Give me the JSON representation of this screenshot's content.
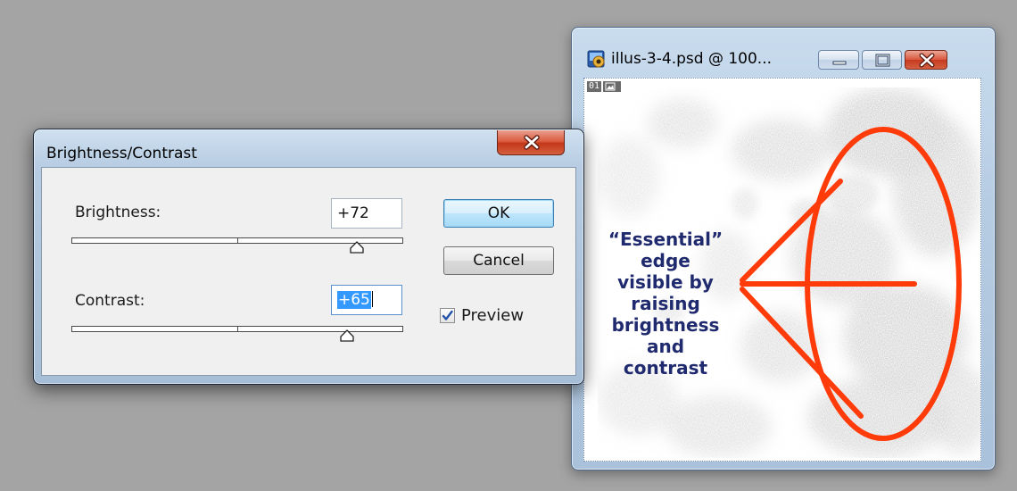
{
  "document_window": {
    "title": "illus-3-4.psd @ 100...",
    "layer_badge": "01",
    "annotation": [
      "“Essential”",
      "edge",
      "visible by",
      "raising",
      "brightness",
      "and",
      "contrast"
    ],
    "annotation_color": "#202a6e",
    "highlight_color": "#ff3b0a"
  },
  "dialog": {
    "title": "Brightness/Contrast",
    "brightness": {
      "label": "Brightness:",
      "value": "+72",
      "slider_level": 0.86
    },
    "contrast": {
      "label": "Contrast:",
      "value": "+65",
      "slider_level": 0.83
    },
    "ok_label": "OK",
    "cancel_label": "Cancel",
    "preview": {
      "label": "Preview",
      "checked": true
    }
  }
}
